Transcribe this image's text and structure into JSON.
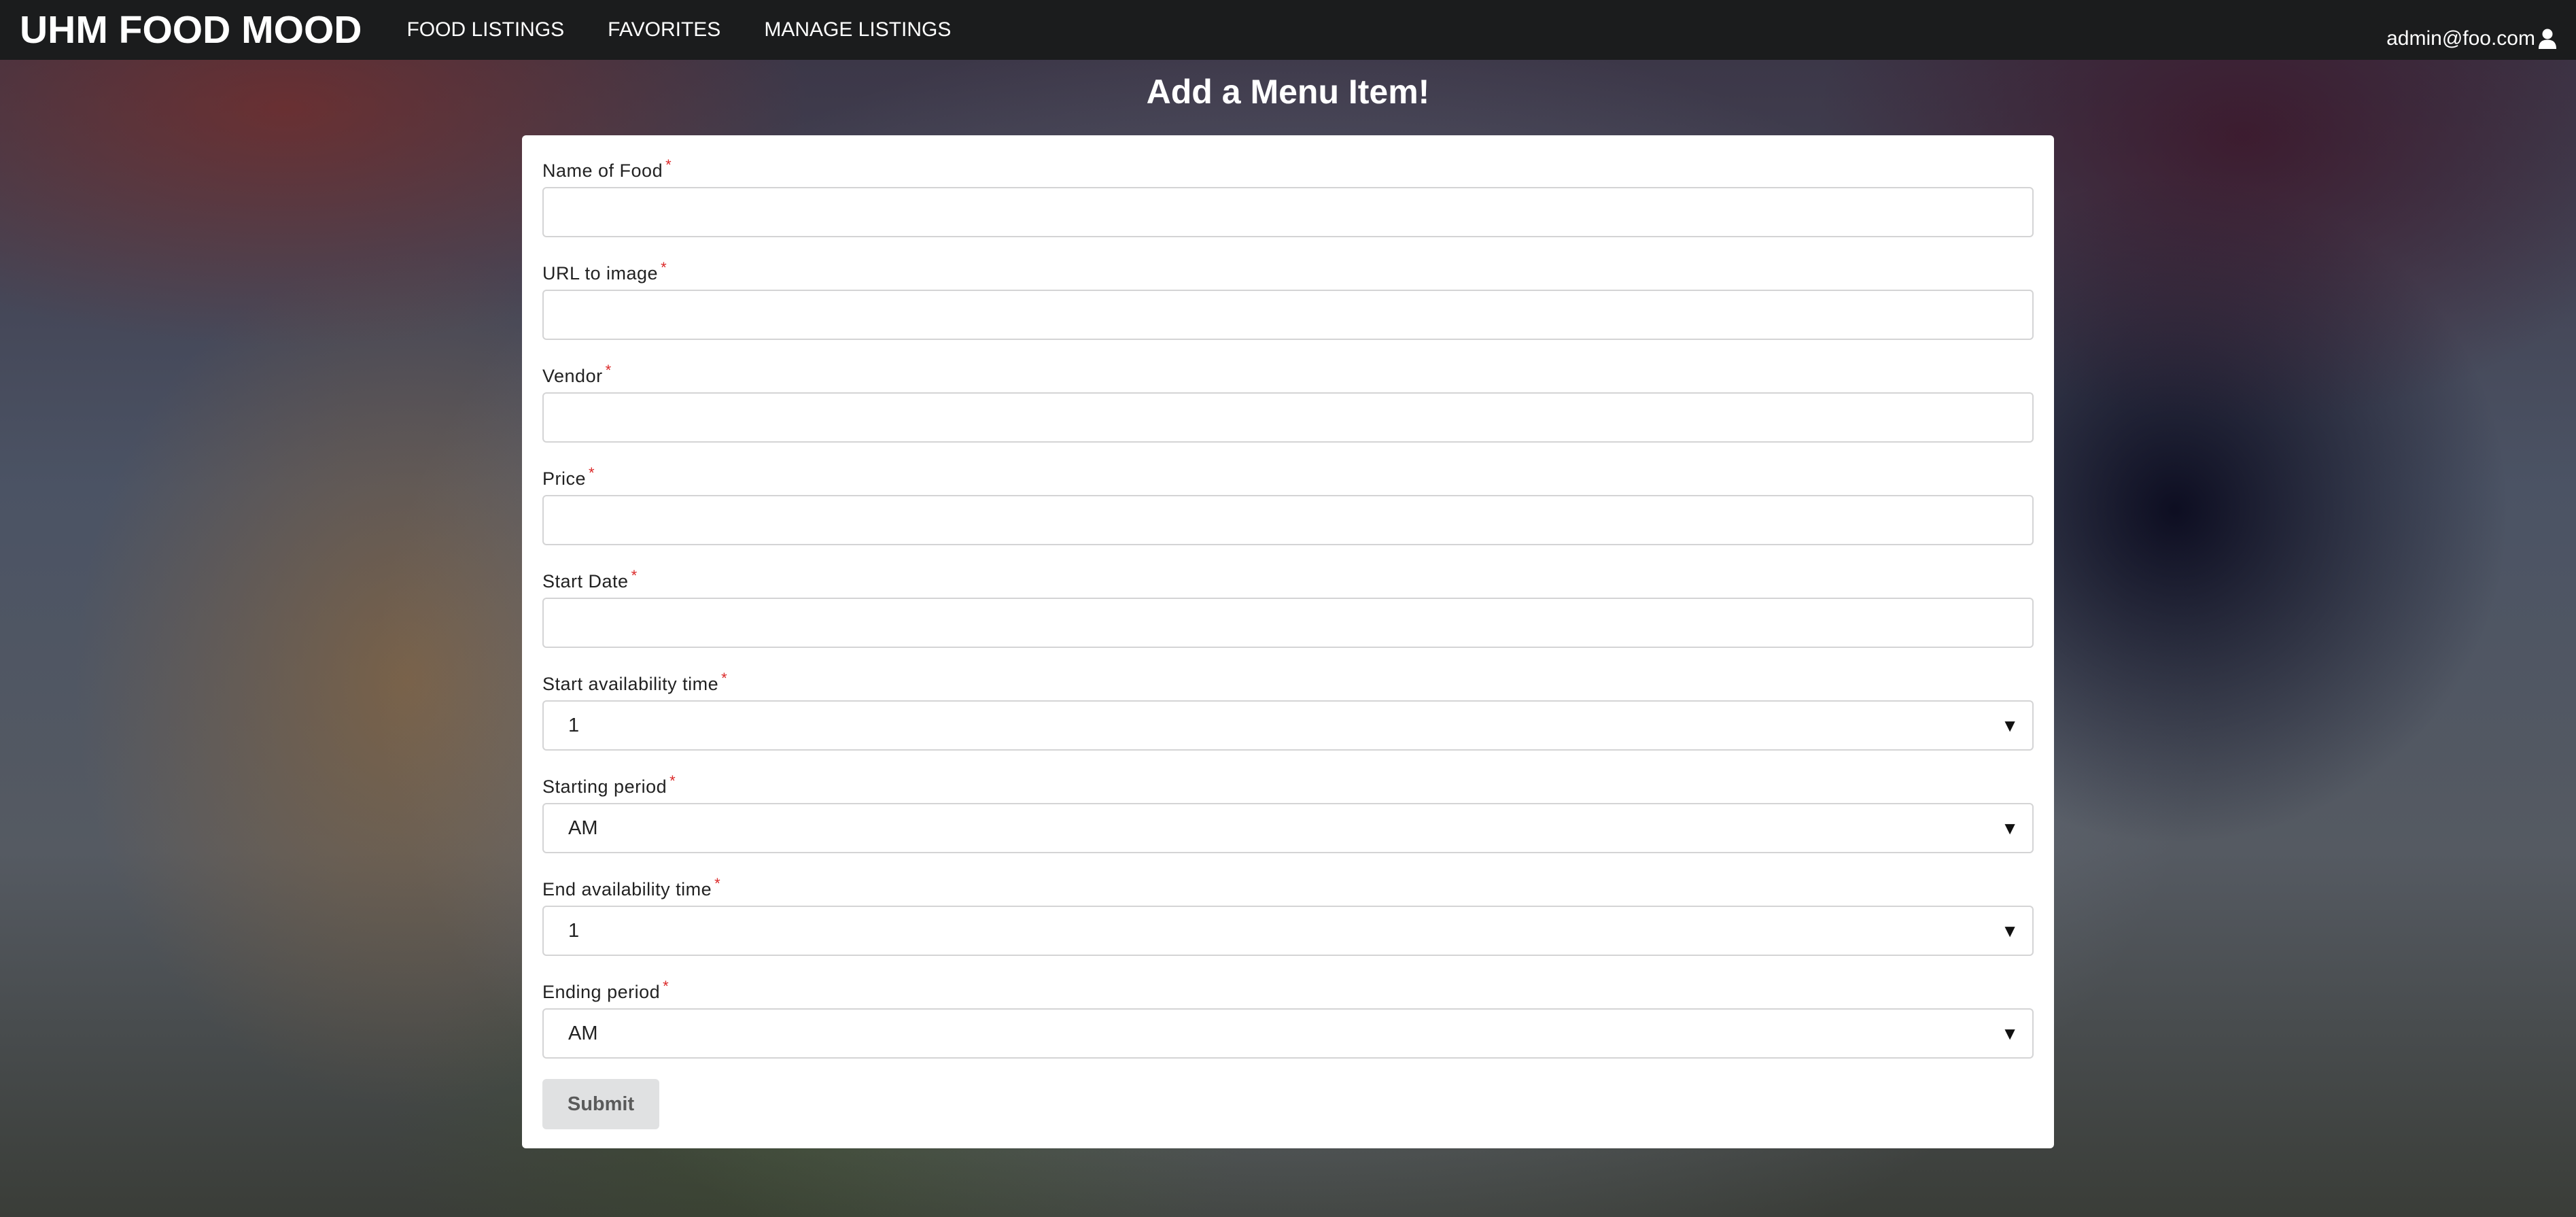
{
  "navbar": {
    "brand": "UHM FOOD MOOD",
    "items": [
      "FOOD LISTINGS",
      "FAVORITES",
      "MANAGE LISTINGS"
    ],
    "user": "admin@foo.com",
    "user_icon": "user-icon"
  },
  "page": {
    "title": "Add a Menu Item!"
  },
  "form": {
    "required_marker": "*",
    "fields": [
      {
        "label": "Name of Food",
        "value": ""
      },
      {
        "label": "URL to image",
        "value": ""
      },
      {
        "label": "Vendor",
        "value": ""
      },
      {
        "label": "Price",
        "value": ""
      },
      {
        "label": "Start Date",
        "value": ""
      },
      {
        "label": "Start availability time",
        "value": "1"
      },
      {
        "label": "Starting period",
        "value": "AM"
      },
      {
        "label": "End availability time",
        "value": "1"
      },
      {
        "label": "Ending period",
        "value": "AM"
      }
    ],
    "submit_label": "Submit"
  },
  "colors": {
    "navbar": "#1b1c1d",
    "required": "#db2828",
    "button": "#e0e1e2"
  }
}
